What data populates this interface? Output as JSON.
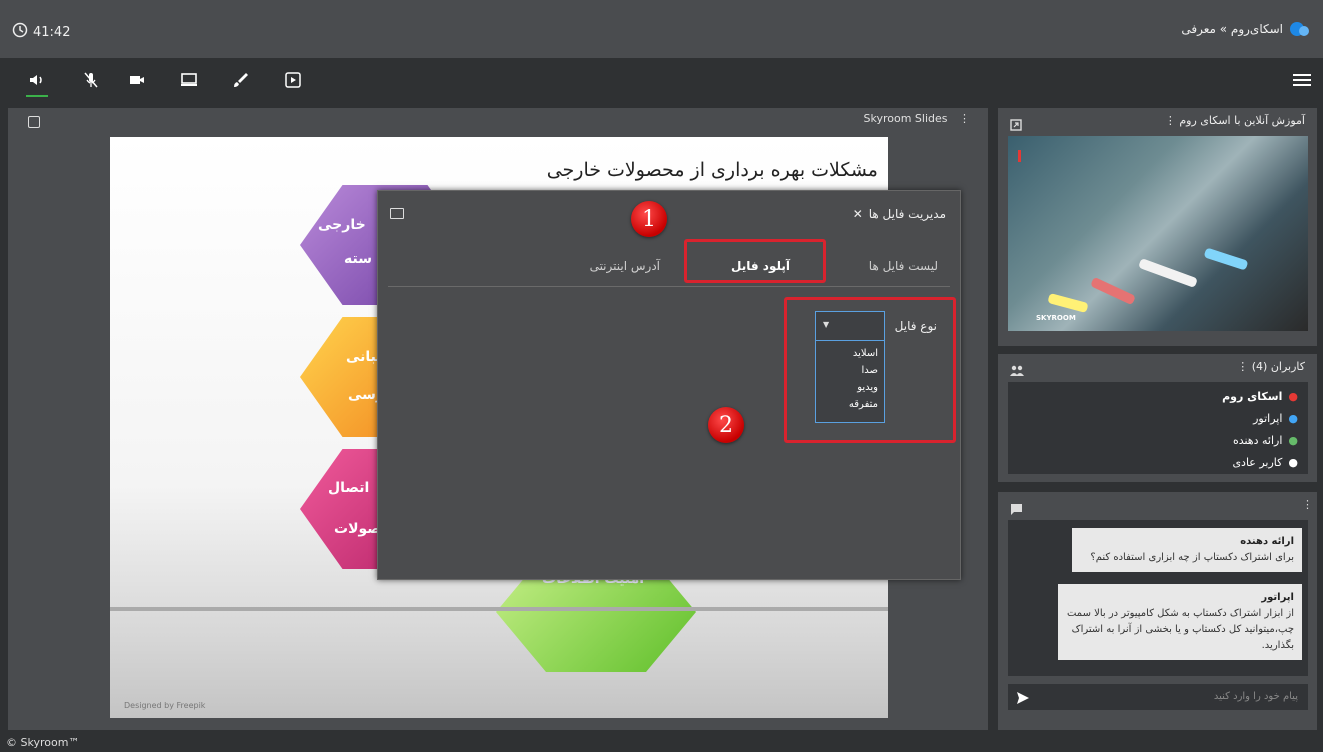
{
  "header": {
    "timer": "41:42",
    "brand": "اسکای‌روم » معرفی"
  },
  "slides_panel": {
    "title": "Skyroom Slides"
  },
  "slide": {
    "title": "مشکلات بهره برداری از محصولات خارجی",
    "designed_by": "Designed by Freepik",
    "hex_labels": [
      "خارجی",
      "سته",
      "یبانی",
      "رسی",
      "اتصال",
      "صولات",
      "امنیت اطلاعات"
    ]
  },
  "dialog": {
    "title": "مدیریت فایل ها",
    "tabs": [
      "لیست فایل ها",
      "آپلود فایل",
      "آدرس اینترنتی"
    ],
    "active_tab": "آپلود فایل",
    "file_type_label": "نوع فایل",
    "file_type_options": [
      "اسلاید",
      "صدا",
      "ویدیو",
      "متفرقه"
    ],
    "badges": [
      "1",
      "2"
    ]
  },
  "video_panel": {
    "title": "آموزش آنلاین با اسکای روم",
    "watermark": "SKYROOM"
  },
  "users_panel": {
    "title": "کاربران (4)",
    "users": [
      {
        "name": "اسکای روم",
        "color": "#e53935"
      },
      {
        "name": "اپراتور",
        "color": "#42a5f5"
      },
      {
        "name": "ارائه دهنده",
        "color": "#66bb6a"
      },
      {
        "name": "کاربر عادی",
        "color": "#ffffff"
      }
    ]
  },
  "chat_panel": {
    "messages": [
      {
        "sender": "ارائه دهنده",
        "text": "برای اشتراک دکستاپ از چه ابزاری استفاده کنم؟"
      },
      {
        "sender": "اپراتور",
        "text": "از ابزار اشتراک دکستاپ به شکل کامپیوتر در بالا سمت چپ،میتوانید کل دکستاپ و یا بخشی از آنرا به اشتراک بگذارید."
      }
    ],
    "input_placeholder": "پیام خود را وارد کنید"
  },
  "footer": {
    "copyright": "© Skyroom™"
  },
  "colors": {
    "highlight": "#d9232e",
    "accent": "#1e88e5",
    "panel": "#4a4c4f"
  }
}
